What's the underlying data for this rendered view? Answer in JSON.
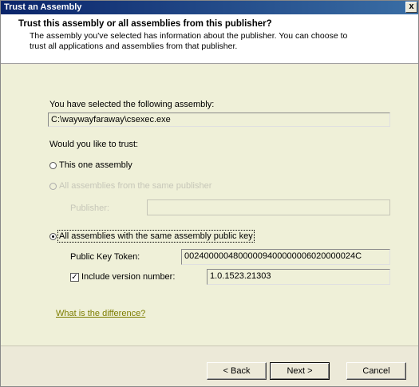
{
  "window": {
    "title": "Trust an Assembly",
    "close_glyph": "x"
  },
  "header": {
    "title": "Trust this assembly or all assemblies from this publisher?",
    "subtitle": "The assembly you've selected has information about the publisher. You can choose to trust all applications and assemblies from that publisher."
  },
  "selected_assembly": {
    "label": "You have selected the following assembly:",
    "value": "C:\\waywayfaraway\\csexec.exe"
  },
  "trust_question": "Would you like to trust:",
  "options": {
    "one_assembly": "This one assembly",
    "same_publisher": "All assemblies from the same publisher",
    "publisher_label": "Publisher:",
    "publisher_value": "",
    "same_key": "All assemblies with the same assembly public key",
    "public_key_label": "Public Key Token:",
    "public_key_value": "00240000048000009400000006020000024C",
    "include_version_label": "Include version number:",
    "include_version_checked": true,
    "version_value": "1.0.1523.21303",
    "selected": "same_key"
  },
  "link": "What is the difference?",
  "buttons": {
    "back": "< Back",
    "next": "Next >",
    "cancel": "Cancel"
  },
  "colors": {
    "body_bg": "#EFF0D8",
    "title_bar": "#0A246A",
    "link": "#7d7d00"
  }
}
